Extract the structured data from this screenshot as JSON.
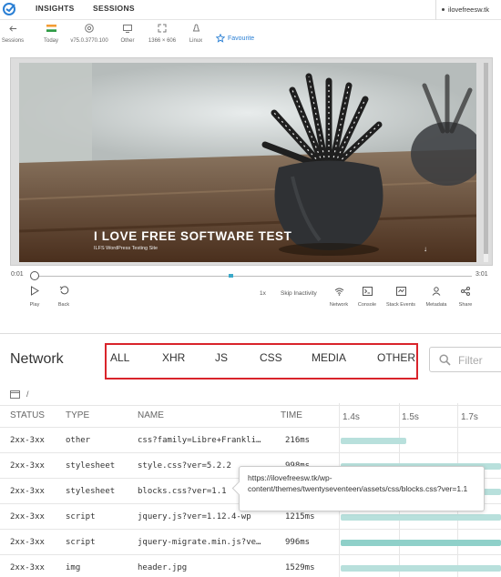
{
  "nav": {
    "tabs": [
      "INSIGHTS",
      "SESSIONS"
    ],
    "account": "ilovefreesw.tk"
  },
  "session_info": {
    "back_label": "Sessions",
    "items": [
      {
        "icon": "flag-icon",
        "label": "Today"
      },
      {
        "icon": "chrome-icon",
        "label": "v75.0.3770.100"
      },
      {
        "icon": "monitor-icon",
        "label": "Other"
      },
      {
        "icon": "resolution-icon",
        "label": "1366 × 606"
      },
      {
        "icon": "linux-icon",
        "label": "Linux"
      }
    ],
    "favourite_label": "Favourite"
  },
  "video": {
    "title": "I LOVE FREE SOFTWARE TEST",
    "subtitle": "ILFS WordPress Testing Site"
  },
  "timeline": {
    "start": "0:01",
    "end": "3:01"
  },
  "controls": {
    "play": "Play",
    "back": "Back",
    "speed": "1x",
    "skip": "Skip Inactivity",
    "network": "Network",
    "console": "Console",
    "stack_events": "Stack Events",
    "metadata": "Metadata",
    "share": "Share"
  },
  "network": {
    "title": "Network",
    "filters": [
      "ALL",
      "XHR",
      "JS",
      "CSS",
      "MEDIA",
      "OTHER"
    ],
    "search_placeholder": "Filter",
    "breadcrumb": "/",
    "columns": {
      "status": "STATUS",
      "type": "TYPE",
      "name": "NAME",
      "time": "TIME"
    },
    "timeline_ticks": [
      "1.4s",
      "1.5s",
      "1.7s"
    ],
    "rows": [
      {
        "status": "2xx-3xx",
        "type": "other",
        "name": "css?family=Libre+Frankli…",
        "time": "216ms"
      },
      {
        "status": "2xx-3xx",
        "type": "stylesheet",
        "name": "style.css?ver=5.2.2",
        "time": "998ms"
      },
      {
        "status": "2xx-3xx",
        "type": "stylesheet",
        "name": "blocks.css?ver=1.1",
        "time": ""
      },
      {
        "status": "2xx-3xx",
        "type": "script",
        "name": "jquery.js?ver=1.12.4-wp",
        "time": "1215ms"
      },
      {
        "status": "2xx-3xx",
        "type": "script",
        "name": "jquery-migrate.min.js?ve…",
        "time": "996ms"
      },
      {
        "status": "2xx-3xx",
        "type": "img",
        "name": "header.jpg",
        "time": "1529ms"
      }
    ],
    "tooltip": "https://ilovefreesw.tk/wp-content/themes/twentyseventeen/assets/css/blocks.css?ver=1.1"
  },
  "colors": {
    "accent_blue": "#2a7fd4",
    "highlight_red": "#d9242b",
    "bar_teal": "#b8e0dc"
  }
}
